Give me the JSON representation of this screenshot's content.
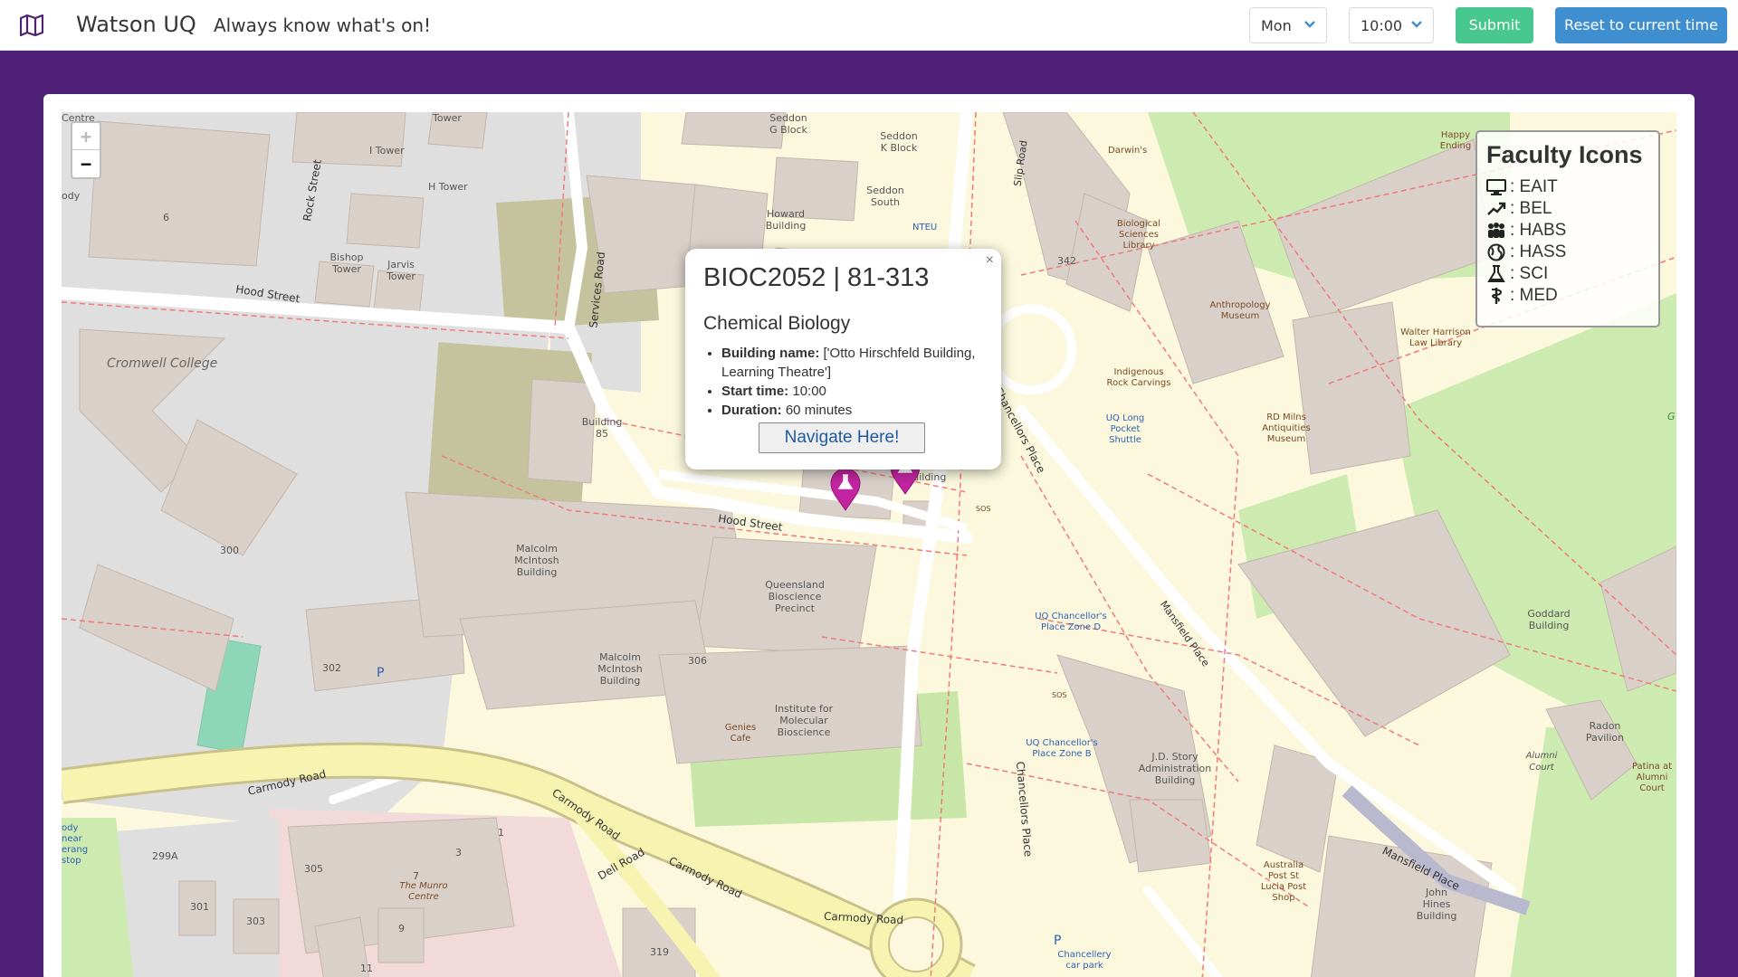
{
  "navbar": {
    "logo_icon": "map-icon",
    "brand": "Watson UQ",
    "tagline": "Always know what's on!",
    "day_select": "Mon",
    "time_select": "10:00",
    "submit_label": "Submit",
    "reset_label": "Reset to current time",
    "colors": {
      "submit": "#48c78e",
      "reset": "#3e8ed0",
      "page_bg": "#4f2278"
    }
  },
  "map": {
    "zoom_in": "+",
    "zoom_out": "−",
    "legend": {
      "title": "Faculty Icons",
      "items": [
        {
          "icon": "desktop-icon",
          "label": ": EAIT"
        },
        {
          "icon": "trend-arrow-icon",
          "label": ": BEL"
        },
        {
          "icon": "people-icon",
          "label": ": HABS"
        },
        {
          "icon": "globe-icon",
          "label": ": HASS"
        },
        {
          "icon": "flask-icon",
          "label": ": SCI"
        },
        {
          "icon": "staff-snake-icon",
          "label": ": MED"
        }
      ]
    },
    "popup": {
      "close": "×",
      "title": "BIOC2052 | 81-313",
      "subtitle": "Chemical Biology",
      "building_label": "Building name:",
      "building_value": "['Otto Hirschfeld Building, Learning Theatre']",
      "start_label": "Start time:",
      "start_value": "10:00",
      "duration_label": "Duration:",
      "duration_value": "60 minutes",
      "navigate_label": "Navigate Here!"
    },
    "marker_color": "#c2259f",
    "labels": {
      "cromwell": "Cromwell College",
      "hood_street": "Hood Street",
      "hood_street2": "Hood Street",
      "rock_street": "Rock Street",
      "services_road": "Services Road",
      "slip_road": "Slip Road",
      "i_tower": "I Tower",
      "h_tower": "H Tower",
      "tower": "Tower",
      "bishop_tower": "Bishop Tower",
      "jarvis_tower": "Jarvis Tower",
      "seddon_g": "Seddon G Block",
      "seddon_k": "Seddon K Block",
      "seddon_south": "Seddon South",
      "howard": "Howard Building",
      "neu": "NTEU",
      "building_85": "Building 85",
      "malcolm1": "Malcolm McIntosh Building",
      "malcolm2": "Malcolm McIntosh Building",
      "qbp": "Queensland Bioscience Precinct",
      "imb": "Institute for Molecular Bioscience",
      "genies": "Genies Cafe",
      "carmody1": "Carmody Road",
      "carmody2": "Carmody Road",
      "carmody3": "Carmody Road",
      "carmody4": "Carmody Road",
      "dell": "Dell Road",
      "chancellors": "Chancellors Place",
      "chancellors_place": "Chancellors Place",
      "mansfield": "Mansfield Place",
      "mansfield2": "Mansfield Place",
      "darwins": "Darwin's",
      "bio_lib": "Biological Sciences Library",
      "anthro": "Anthropology Museum",
      "walter": "Walter Harrison Law Library",
      "rdmilns": "RD Milns Antiquities Museum",
      "indig": "Indigenous Rock Carvings",
      "shuttle": "UQ Long Pocket Shuttle",
      "zone_d": "UQ Chancellor's Place Zone D",
      "zone_b": "UQ Chancellor's Place Zone B",
      "jd_story": "J.D. Story Administration Building",
      "post": "Australia Post St Lucia Post Shop",
      "goddard": "Goddard Building",
      "john_hines": "John Hines Building",
      "radon": "Radon Pavilion",
      "alumni": "Alumni Court",
      "patina": "Patina at Alumni Court",
      "happy": "Happy Ending",
      "munro": "The Munro Centre",
      "chancellery": "Chancellery car park",
      "n342": "342",
      "n300": "300",
      "n302": "302",
      "n306": "306",
      "n305": "305",
      "n3": "3",
      "n1": "1",
      "n7": "7",
      "n9": "9",
      "n11": "11",
      "n301": "301",
      "n303": "303",
      "n299a": "299A",
      "n319": "319",
      "n6": "6",
      "letter_p": "P",
      "letter_p2": "P",
      "otto": "Hirschfeld Building",
      "body_left": "ody",
      "body_near": "ody near erang stop",
      "centre": "Centre",
      "g_right": "G",
      "sos1": "SOS",
      "sos2": "SOS"
    }
  }
}
